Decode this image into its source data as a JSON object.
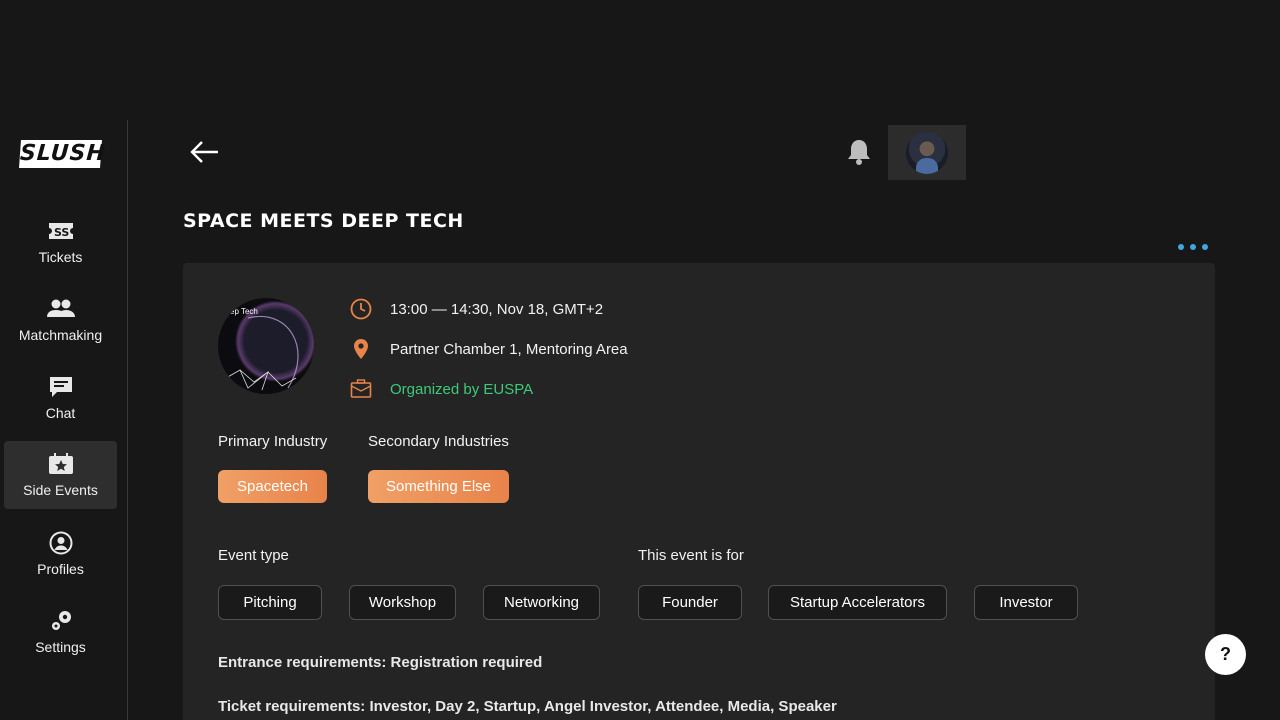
{
  "app": {
    "logo": "SLUSH"
  },
  "sidebar": {
    "items": [
      {
        "label": "Tickets",
        "icon": "ticket-icon"
      },
      {
        "label": "Matchmaking",
        "icon": "people-icon"
      },
      {
        "label": "Chat",
        "icon": "chat-icon"
      },
      {
        "label": "Side Events",
        "icon": "calendar-star-icon",
        "active": true
      },
      {
        "label": "Profiles",
        "icon": "profile-icon"
      },
      {
        "label": "Settings",
        "icon": "gear-icon"
      }
    ]
  },
  "header": {
    "back_icon": "arrow-left-icon",
    "bell_icon": "bell-icon"
  },
  "event": {
    "title": "SPACE MEETS DEEP TECH",
    "image_text": "ep Tech",
    "time": "13:00 — 14:30, Nov 18, GMT+2",
    "location": "Partner Chamber 1, Mentoring Area",
    "organizer": "Organized by EUSPA",
    "primary_industry_label": "Primary Industry",
    "primary_industry": "Spacetech",
    "secondary_industries_label": "Secondary Industries",
    "secondary_industries": [
      "Something Else"
    ],
    "event_type_label": "Event type",
    "event_types": [
      "Pitching",
      "Workshop",
      "Networking"
    ],
    "audience_label": "This event is for",
    "audience": [
      "Founder",
      "Startup Accelerators",
      "Investor"
    ],
    "entrance_requirements": "Entrance requirements: Registration required",
    "ticket_requirements": "Ticket requirements: Investor, Day 2, Startup, Angel Investor, Attendee, Media, Speaker"
  },
  "help": {
    "label": "?"
  },
  "colors": {
    "accent_orange": "#e8834a",
    "organizer_green": "#3ec97a",
    "more_dots_blue": "#3fa8e0"
  }
}
